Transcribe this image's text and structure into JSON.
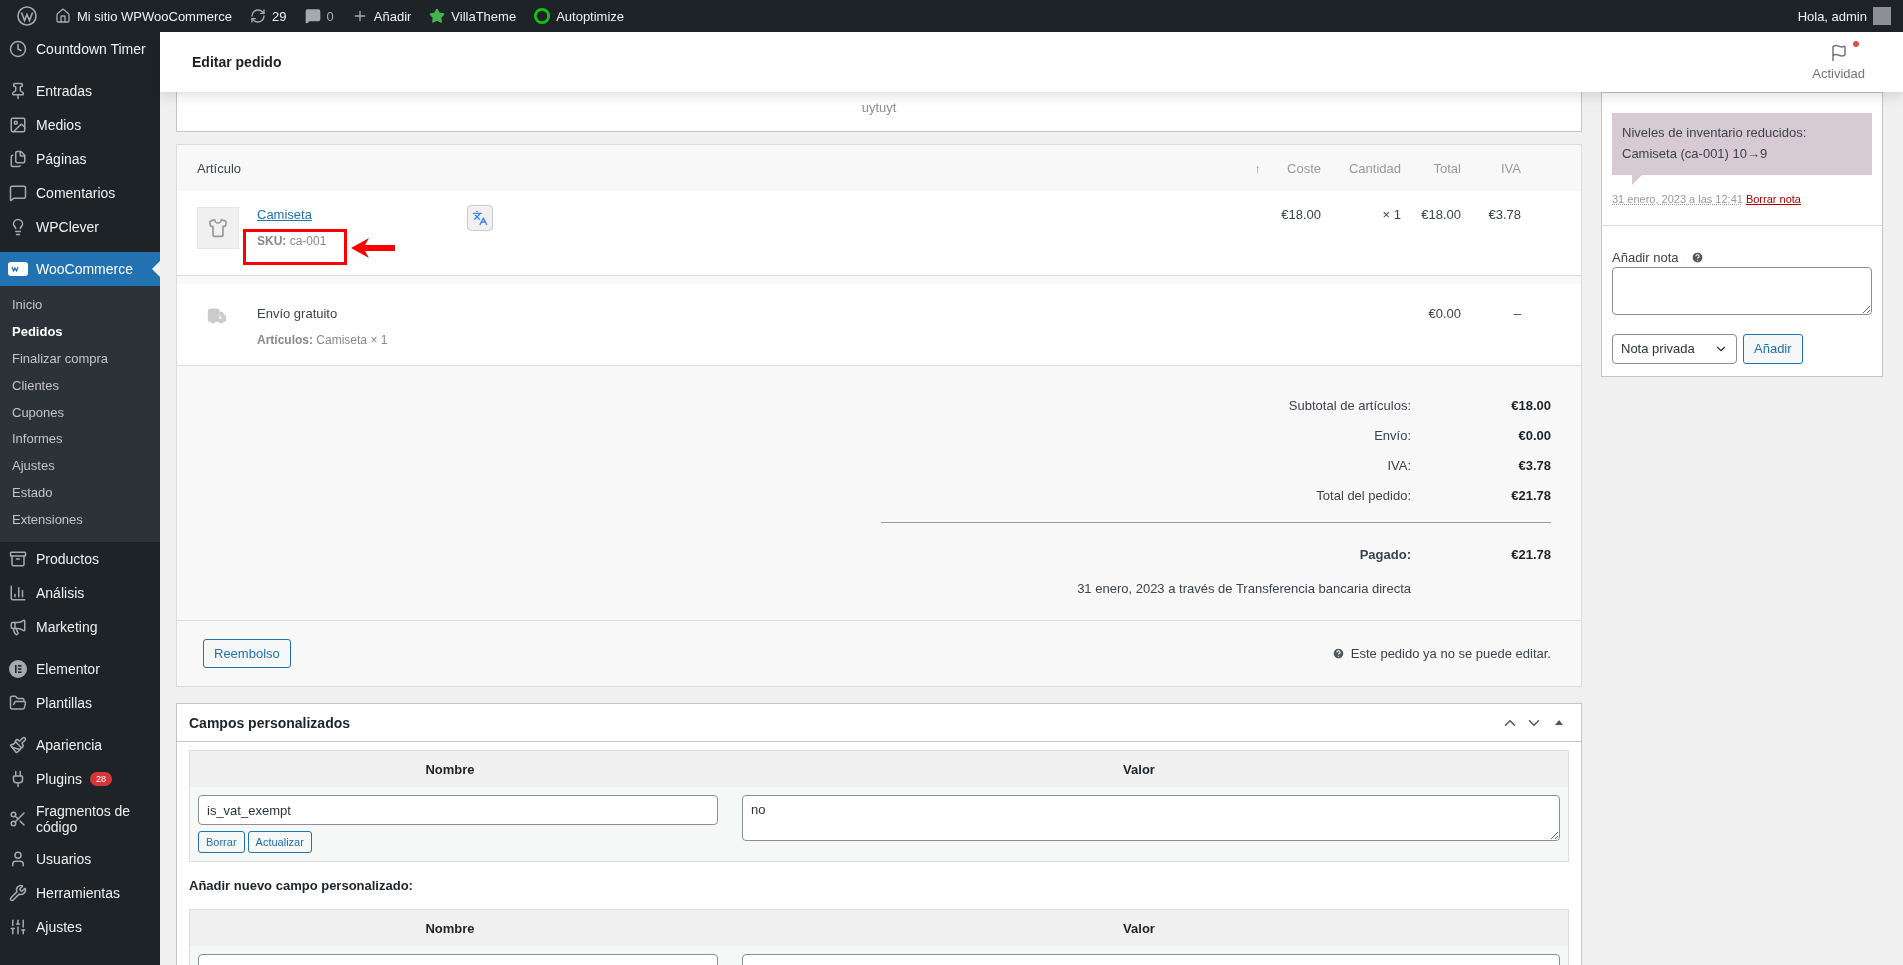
{
  "admin_bar": {
    "items": [
      {
        "kind": "wp"
      },
      {
        "kind": "home",
        "label": "Mi sitio WPWooCommerce"
      },
      {
        "kind": "updates",
        "label": "29"
      },
      {
        "kind": "comments",
        "label": "0"
      },
      {
        "kind": "new",
        "label": "Añadir"
      },
      {
        "kind": "star",
        "label": "VillaTheme"
      },
      {
        "kind": "ring",
        "label": "Autoptimize"
      }
    ],
    "greeting": "Hola, admin"
  },
  "sidebar": {
    "items": [
      {
        "kind": "clock",
        "label": "Countdown Timer",
        "selected": false
      },
      {
        "kind": "pin",
        "label": "Entradas",
        "selected": false
      },
      {
        "kind": "media",
        "label": "Medios",
        "selected": false
      },
      {
        "kind": "pages",
        "label": "Páginas",
        "selected": false
      },
      {
        "kind": "comment",
        "label": "Comentarios",
        "selected": false
      },
      {
        "kind": "bulb",
        "label": "WPClever",
        "selected": false
      },
      {
        "kind": "woo",
        "label": "WooCommerce",
        "selected": true,
        "children": [
          {
            "label": "Inicio",
            "selected": false
          },
          {
            "label": "Pedidos",
            "selected": true
          },
          {
            "label": "Finalizar compra",
            "selected": false
          },
          {
            "label": "Clientes",
            "selected": false
          },
          {
            "label": "Cupones",
            "selected": false
          },
          {
            "label": "Informes",
            "selected": false
          },
          {
            "label": "Ajustes",
            "selected": false
          },
          {
            "label": "Estado",
            "selected": false
          },
          {
            "label": "Extensiones",
            "selected": false
          }
        ]
      },
      {
        "kind": "archive",
        "label": "Productos",
        "selected": false
      },
      {
        "kind": "chart",
        "label": "Análisis",
        "selected": false
      },
      {
        "kind": "megaphone",
        "label": "Marketing",
        "selected": false
      },
      {
        "kind": "elementor",
        "label": "Elementor",
        "selected": false
      },
      {
        "kind": "folder",
        "label": "Plantillas",
        "selected": false
      },
      {
        "kind": "brush",
        "label": "Apariencia",
        "selected": false
      },
      {
        "kind": "plug",
        "label": "Plugins",
        "selected": false,
        "badge": "28"
      },
      {
        "kind": "scissors",
        "label": "Fragmentos de código",
        "selected": false
      },
      {
        "kind": "user",
        "label": "Usuarios",
        "selected": false
      },
      {
        "kind": "wrench",
        "label": "Herramientas",
        "selected": false
      },
      {
        "kind": "sliders",
        "label": "Ajustes",
        "selected": false
      }
    ]
  },
  "header": {
    "title": "Editar pedido",
    "activity": "Actividad",
    "unread": true
  },
  "top_box": {
    "text": "uytuyt"
  },
  "order_items": {
    "columns": [
      "Artículo",
      "↑",
      "Coste",
      "Cantidad",
      "Total",
      "IVA"
    ],
    "rows": [
      {
        "kind": "product",
        "name": "Camiseta",
        "sku_label": "SKU:",
        "sku": "ca-001",
        "cost": "€18.00",
        "quantity": "× 1",
        "total": "€18.00",
        "tax": "€3.78",
        "highlighted": true
      },
      {
        "kind": "shipping",
        "name": "Envío gratuito",
        "meta_label": "Artículos:",
        "meta": "Camiseta × 1",
        "total": "€0.00",
        "tax": "–"
      }
    ],
    "totals": [
      {
        "label": "Subtotal de artículos:",
        "value": "€18.00"
      },
      {
        "label": "Envío:",
        "value": "€0.00"
      },
      {
        "label": "IVA:",
        "value": "€3.78"
      },
      {
        "label": "Total del pedido:",
        "value": "€21.78"
      }
    ],
    "paid": {
      "label": "Pagado:",
      "value": "€21.78",
      "note": "31 enero, 2023 a través de Transferencia bancaria directa"
    },
    "refund_button": "Reembolso",
    "notice": "Este pedido ya no se puede editar."
  },
  "custom_fields": {
    "title": "Campos personalizados",
    "columns": [
      "Nombre",
      "Valor"
    ],
    "rows": [
      {
        "name": "is_vat_exempt",
        "value": "no",
        "buttons": [
          "Borrar",
          "Actualizar"
        ]
      }
    ],
    "add_label": "Añadir nuevo campo personalizado:",
    "add_columns": [
      "Nombre",
      "Valor"
    ]
  },
  "notes": {
    "items": [
      {
        "text": "Niveles de inventario reducidos: Camiseta (ca-001) 10→9",
        "date": "31 enero, 2023 a las 12:41",
        "delete": "Borrar nota"
      }
    ],
    "add_label": "Añadir nota",
    "note_type": "Nota privada",
    "add_button": "Añadir"
  }
}
